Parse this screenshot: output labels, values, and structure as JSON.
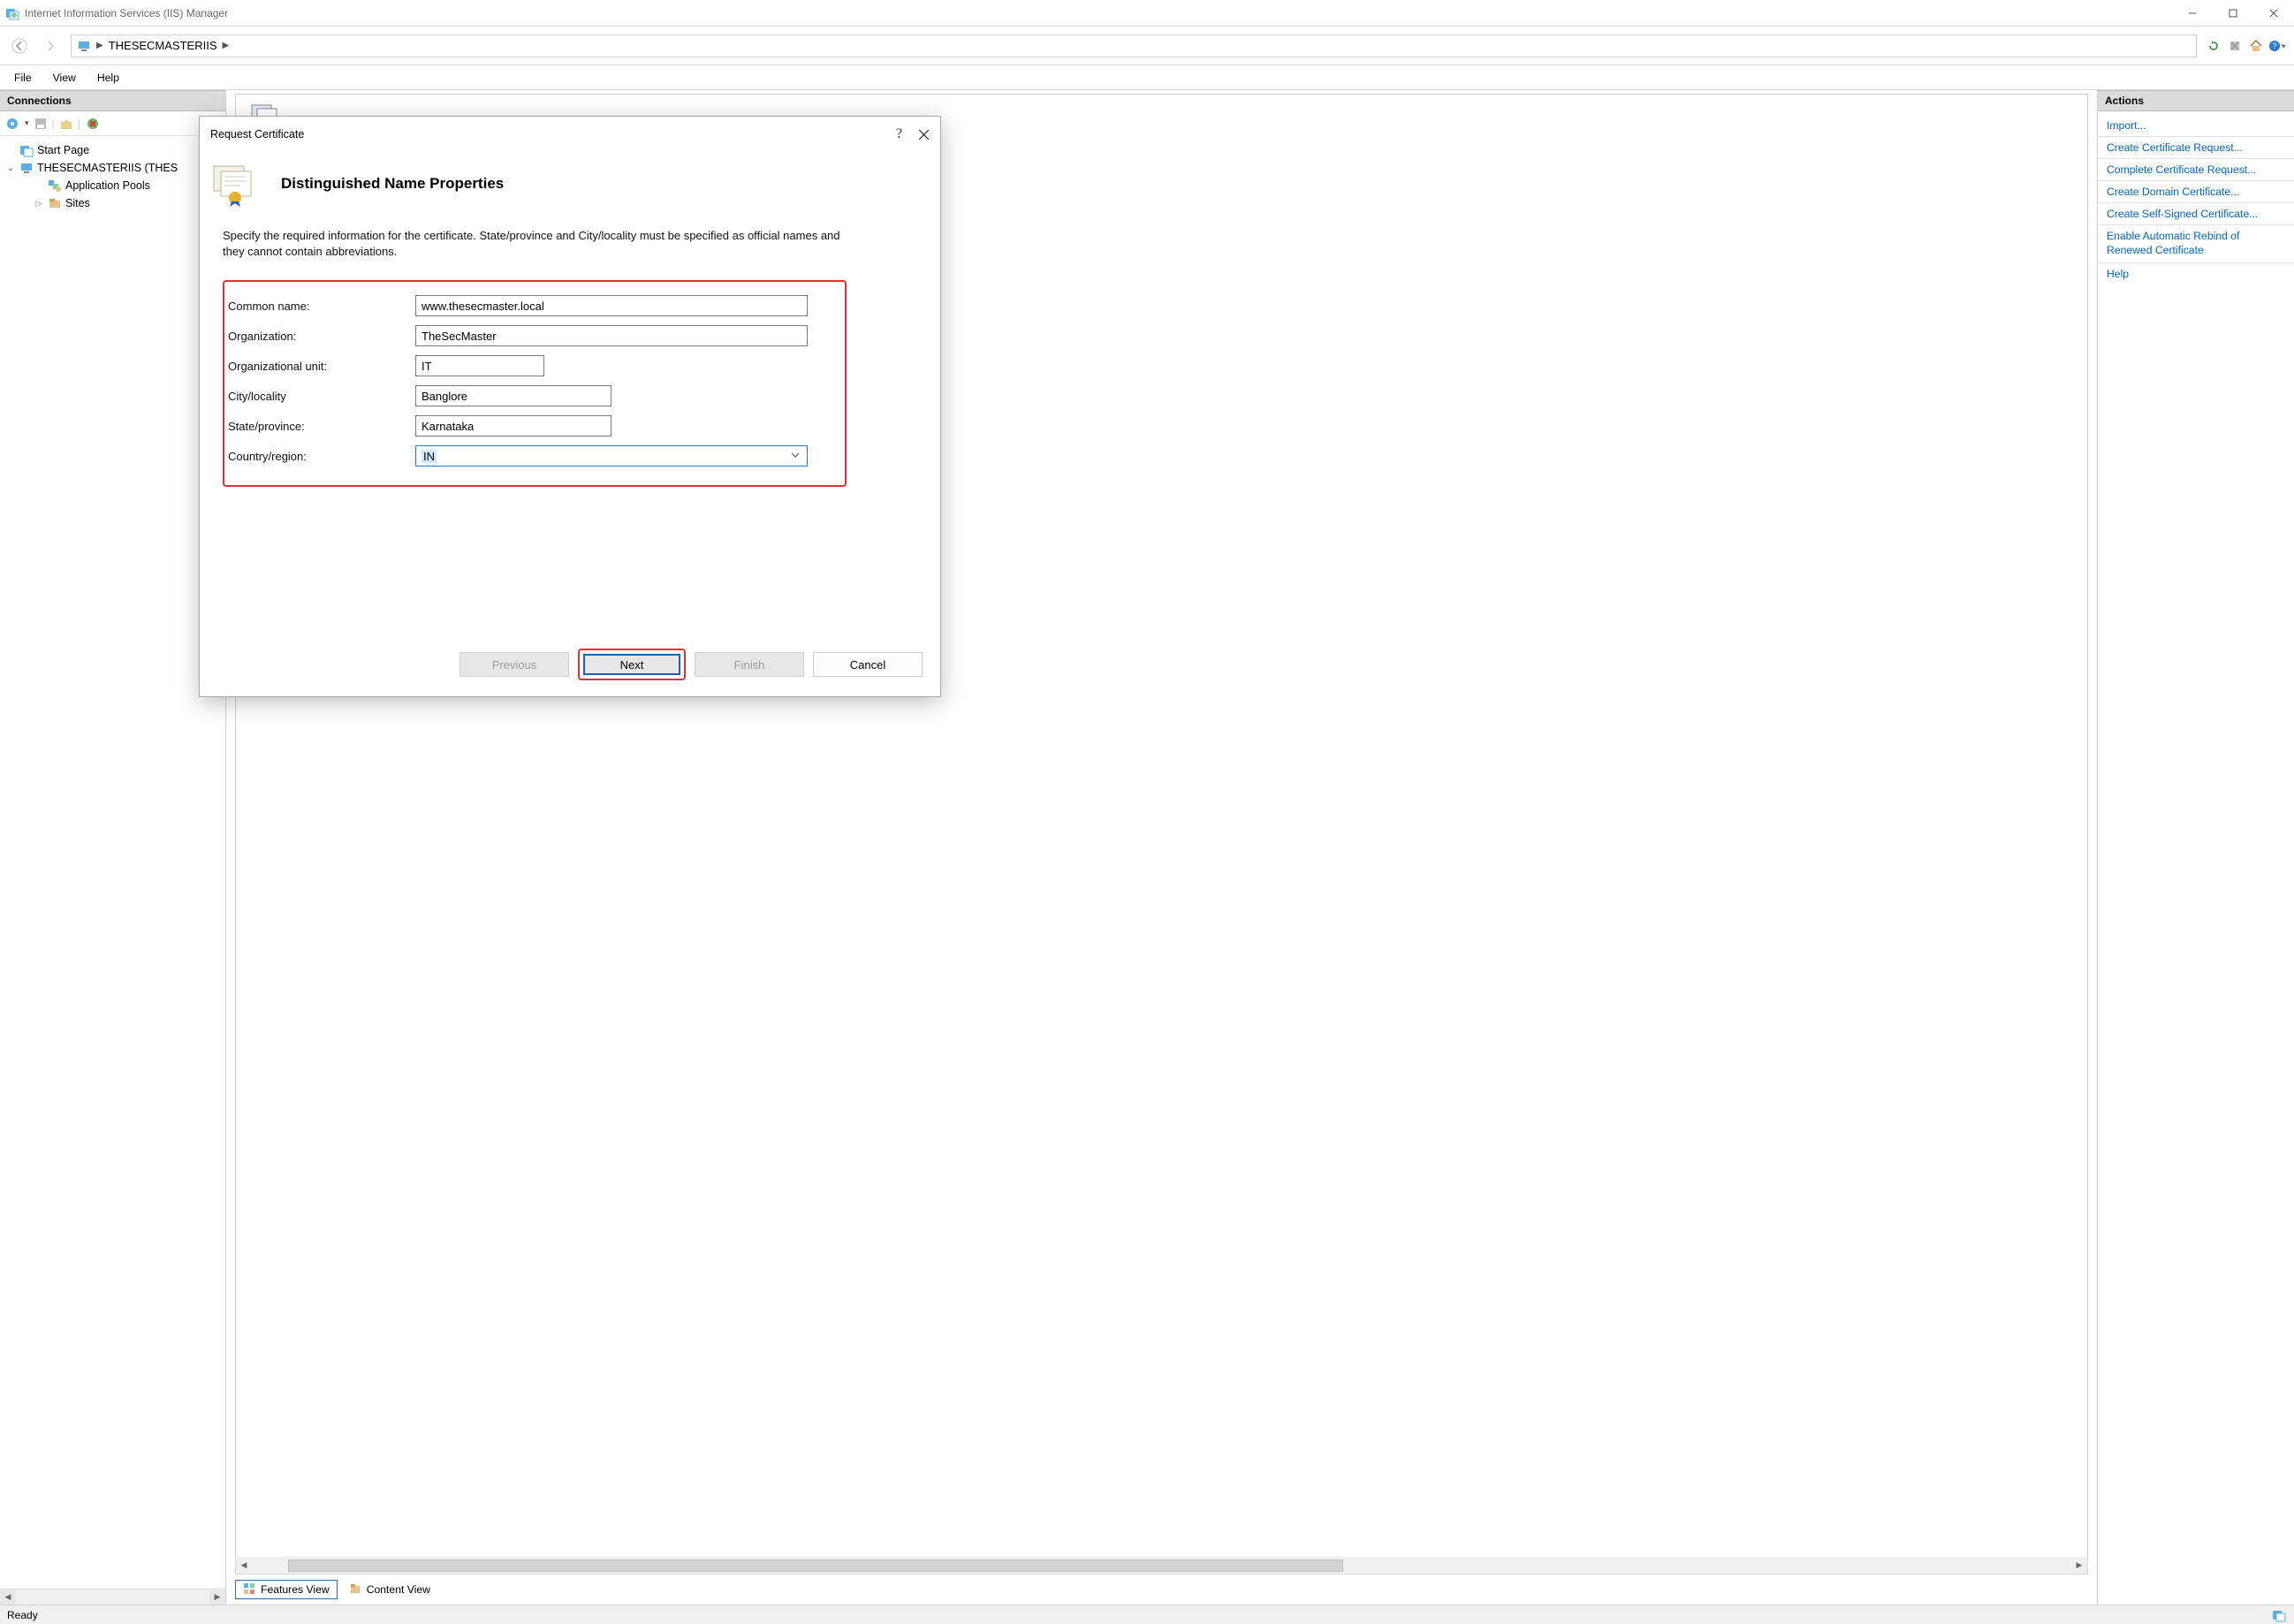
{
  "window": {
    "title": "Internet Information Services (IIS) Manager"
  },
  "breadcrumb": {
    "server": "THESECMASTERIIS"
  },
  "menu": {
    "file": "File",
    "view": "View",
    "help": "Help"
  },
  "panels": {
    "connections_title": "Connections",
    "actions_title": "Actions"
  },
  "tree": {
    "start_page": "Start Page",
    "server_node": "THESECMASTERIIS (THES",
    "app_pools": "Application Pools",
    "sites": "Sites"
  },
  "tabs": {
    "features": "Features View",
    "content": "Content View"
  },
  "actions": [
    "Import...",
    "Create Certificate Request...",
    "Complete Certificate Request...",
    "Create Domain Certificate...",
    "Create Self-Signed Certificate...",
    "Enable Automatic Rebind of Renewed Certificate",
    "Help"
  ],
  "status": {
    "ready": "Ready"
  },
  "dialog": {
    "title": "Request Certificate",
    "heading": "Distinguished Name Properties",
    "description": "Specify the required information for the certificate. State/province and City/locality must be specified as official names and they cannot contain abbreviations.",
    "labels": {
      "common_name": "Common name:",
      "organization": "Organization:",
      "org_unit": "Organizational unit:",
      "city": "City/locality",
      "state": "State/province:",
      "country": "Country/region:"
    },
    "values": {
      "common_name": "www.thesecmaster.local",
      "organization": "TheSecMaster",
      "org_unit": "IT",
      "city": "Banglore",
      "state": "Karnataka",
      "country": "IN"
    },
    "buttons": {
      "previous": "Previous",
      "next": "Next",
      "finish": "Finish",
      "cancel": "Cancel"
    }
  }
}
